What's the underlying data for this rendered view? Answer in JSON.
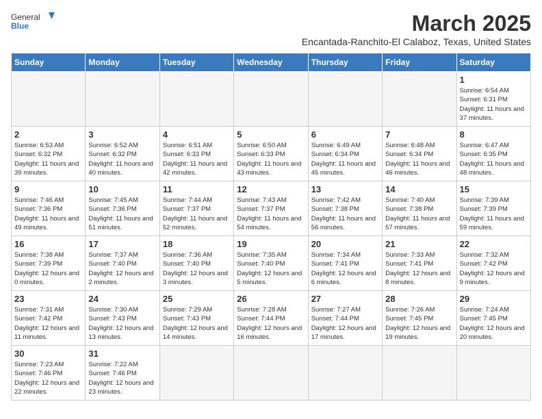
{
  "header": {
    "logo_general": "General",
    "logo_blue": "Blue",
    "month_title": "March 2025",
    "subtitle": "Encantada-Ranchito-El Calaboz, Texas, United States"
  },
  "days_of_week": [
    "Sunday",
    "Monday",
    "Tuesday",
    "Wednesday",
    "Thursday",
    "Friday",
    "Saturday"
  ],
  "weeks": [
    [
      {
        "day": "",
        "empty": true
      },
      {
        "day": "",
        "empty": true
      },
      {
        "day": "",
        "empty": true
      },
      {
        "day": "",
        "empty": true
      },
      {
        "day": "",
        "empty": true
      },
      {
        "day": "",
        "empty": true
      },
      {
        "day": "1",
        "sunrise": "Sunrise: 6:54 AM",
        "sunset": "Sunset: 6:31 PM",
        "daylight": "Daylight: 11 hours and 37 minutes."
      }
    ],
    [
      {
        "day": "2",
        "sunrise": "Sunrise: 6:53 AM",
        "sunset": "Sunset: 6:32 PM",
        "daylight": "Daylight: 11 hours and 39 minutes."
      },
      {
        "day": "3",
        "sunrise": "Sunrise: 6:52 AM",
        "sunset": "Sunset: 6:32 PM",
        "daylight": "Daylight: 11 hours and 40 minutes."
      },
      {
        "day": "4",
        "sunrise": "Sunrise: 6:51 AM",
        "sunset": "Sunset: 6:33 PM",
        "daylight": "Daylight: 11 hours and 42 minutes."
      },
      {
        "day": "5",
        "sunrise": "Sunrise: 6:50 AM",
        "sunset": "Sunset: 6:33 PM",
        "daylight": "Daylight: 11 hours and 43 minutes."
      },
      {
        "day": "6",
        "sunrise": "Sunrise: 6:49 AM",
        "sunset": "Sunset: 6:34 PM",
        "daylight": "Daylight: 11 hours and 45 minutes."
      },
      {
        "day": "7",
        "sunrise": "Sunrise: 6:48 AM",
        "sunset": "Sunset: 6:34 PM",
        "daylight": "Daylight: 11 hours and 46 minutes."
      },
      {
        "day": "8",
        "sunrise": "Sunrise: 6:47 AM",
        "sunset": "Sunset: 6:35 PM",
        "daylight": "Daylight: 11 hours and 48 minutes."
      }
    ],
    [
      {
        "day": "9",
        "sunrise": "Sunrise: 7:46 AM",
        "sunset": "Sunset: 7:36 PM",
        "daylight": "Daylight: 11 hours and 49 minutes."
      },
      {
        "day": "10",
        "sunrise": "Sunrise: 7:45 AM",
        "sunset": "Sunset: 7:36 PM",
        "daylight": "Daylight: 11 hours and 51 minutes."
      },
      {
        "day": "11",
        "sunrise": "Sunrise: 7:44 AM",
        "sunset": "Sunset: 7:37 PM",
        "daylight": "Daylight: 11 hours and 52 minutes."
      },
      {
        "day": "12",
        "sunrise": "Sunrise: 7:43 AM",
        "sunset": "Sunset: 7:37 PM",
        "daylight": "Daylight: 11 hours and 54 minutes."
      },
      {
        "day": "13",
        "sunrise": "Sunrise: 7:42 AM",
        "sunset": "Sunset: 7:38 PM",
        "daylight": "Daylight: 11 hours and 56 minutes."
      },
      {
        "day": "14",
        "sunrise": "Sunrise: 7:40 AM",
        "sunset": "Sunset: 7:38 PM",
        "daylight": "Daylight: 11 hours and 57 minutes."
      },
      {
        "day": "15",
        "sunrise": "Sunrise: 7:39 AM",
        "sunset": "Sunset: 7:39 PM",
        "daylight": "Daylight: 11 hours and 59 minutes."
      }
    ],
    [
      {
        "day": "16",
        "sunrise": "Sunrise: 7:38 AM",
        "sunset": "Sunset: 7:39 PM",
        "daylight": "Daylight: 12 hours and 0 minutes."
      },
      {
        "day": "17",
        "sunrise": "Sunrise: 7:37 AM",
        "sunset": "Sunset: 7:40 PM",
        "daylight": "Daylight: 12 hours and 2 minutes."
      },
      {
        "day": "18",
        "sunrise": "Sunrise: 7:36 AM",
        "sunset": "Sunset: 7:40 PM",
        "daylight": "Daylight: 12 hours and 3 minutes."
      },
      {
        "day": "19",
        "sunrise": "Sunrise: 7:35 AM",
        "sunset": "Sunset: 7:40 PM",
        "daylight": "Daylight: 12 hours and 5 minutes."
      },
      {
        "day": "20",
        "sunrise": "Sunrise: 7:34 AM",
        "sunset": "Sunset: 7:41 PM",
        "daylight": "Daylight: 12 hours and 6 minutes."
      },
      {
        "day": "21",
        "sunrise": "Sunrise: 7:33 AM",
        "sunset": "Sunset: 7:41 PM",
        "daylight": "Daylight: 12 hours and 8 minutes."
      },
      {
        "day": "22",
        "sunrise": "Sunrise: 7:32 AM",
        "sunset": "Sunset: 7:42 PM",
        "daylight": "Daylight: 12 hours and 9 minutes."
      }
    ],
    [
      {
        "day": "23",
        "sunrise": "Sunrise: 7:31 AM",
        "sunset": "Sunset: 7:42 PM",
        "daylight": "Daylight: 12 hours and 11 minutes."
      },
      {
        "day": "24",
        "sunrise": "Sunrise: 7:30 AM",
        "sunset": "Sunset: 7:43 PM",
        "daylight": "Daylight: 12 hours and 13 minutes."
      },
      {
        "day": "25",
        "sunrise": "Sunrise: 7:29 AM",
        "sunset": "Sunset: 7:43 PM",
        "daylight": "Daylight: 12 hours and 14 minutes."
      },
      {
        "day": "26",
        "sunrise": "Sunrise: 7:28 AM",
        "sunset": "Sunset: 7:44 PM",
        "daylight": "Daylight: 12 hours and 16 minutes."
      },
      {
        "day": "27",
        "sunrise": "Sunrise: 7:27 AM",
        "sunset": "Sunset: 7:44 PM",
        "daylight": "Daylight: 12 hours and 17 minutes."
      },
      {
        "day": "28",
        "sunrise": "Sunrise: 7:26 AM",
        "sunset": "Sunset: 7:45 PM",
        "daylight": "Daylight: 12 hours and 19 minutes."
      },
      {
        "day": "29",
        "sunrise": "Sunrise: 7:24 AM",
        "sunset": "Sunset: 7:45 PM",
        "daylight": "Daylight: 12 hours and 20 minutes."
      }
    ],
    [
      {
        "day": "30",
        "sunrise": "Sunrise: 7:23 AM",
        "sunset": "Sunset: 7:46 PM",
        "daylight": "Daylight: 12 hours and 22 minutes."
      },
      {
        "day": "31",
        "sunrise": "Sunrise: 7:22 AM",
        "sunset": "Sunset: 7:46 PM",
        "daylight": "Daylight: 12 hours and 23 minutes."
      },
      {
        "day": "",
        "empty": true
      },
      {
        "day": "",
        "empty": true
      },
      {
        "day": "",
        "empty": true
      },
      {
        "day": "",
        "empty": true
      },
      {
        "day": "",
        "empty": true
      }
    ]
  ]
}
